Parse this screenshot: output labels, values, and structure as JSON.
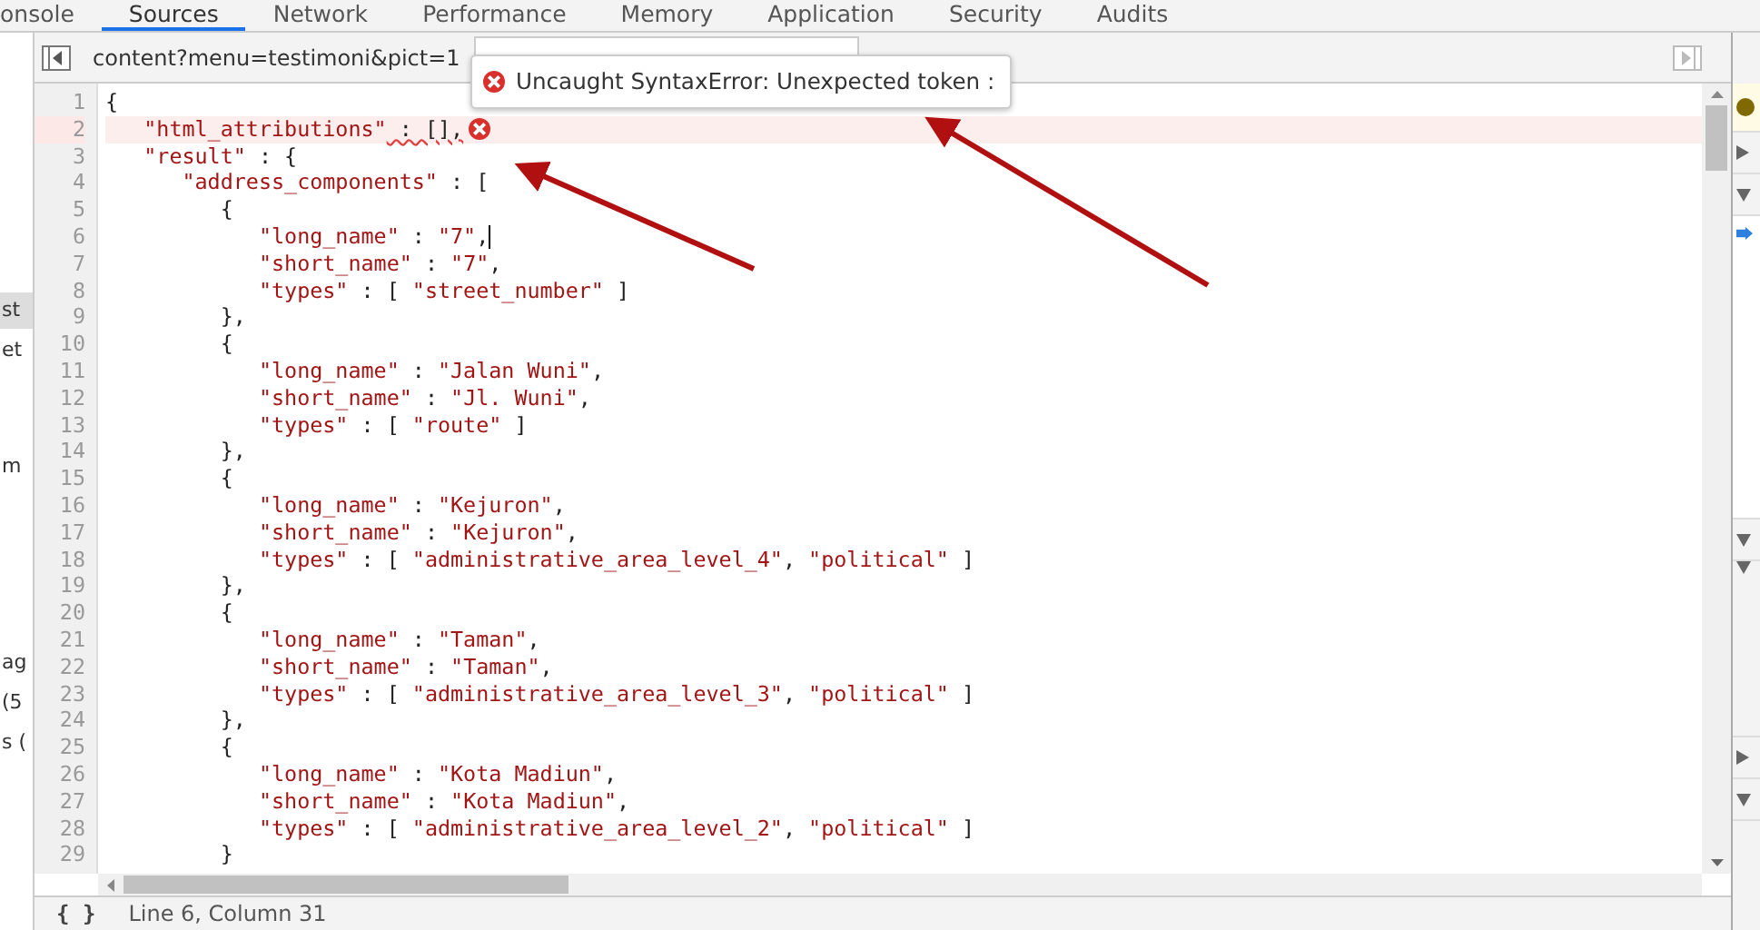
{
  "panel_tabs": [
    {
      "label": "onsole",
      "selected": false
    },
    {
      "label": "Sources",
      "selected": true
    },
    {
      "label": "Network",
      "selected": false
    },
    {
      "label": "Performance",
      "selected": false
    },
    {
      "label": "Memory",
      "selected": false
    },
    {
      "label": "Application",
      "selected": false
    },
    {
      "label": "Security",
      "selected": false
    },
    {
      "label": "Audits",
      "selected": false
    }
  ],
  "navigator": {
    "items": [
      {
        "label": "st",
        "selected": true
      },
      {
        "label": "et",
        "selected": false
      },
      {
        "label": "m",
        "selected": false
      },
      {
        "label": "ag",
        "selected": false
      },
      {
        "label": "(5",
        "selected": false
      },
      {
        "label": "s (",
        "selected": false
      }
    ]
  },
  "editor": {
    "file_tabs": [
      {
        "label": "content?menu=testimoni&pict=1",
        "selected": true
      }
    ],
    "error_tooltip": {
      "message": "Uncaught SyntaxError: Unexpected token :"
    },
    "lines": [
      {
        "number": "1",
        "text": "{",
        "error": false,
        "cursor": false
      },
      {
        "number": "2",
        "text": "   \"html_attributions\" : [],",
        "error": true,
        "cursor": false
      },
      {
        "number": "3",
        "text": "   \"result\" : {",
        "error": false,
        "cursor": false
      },
      {
        "number": "4",
        "text": "      \"address_components\" : [",
        "error": false,
        "cursor": false
      },
      {
        "number": "5",
        "text": "         {",
        "error": false,
        "cursor": false
      },
      {
        "number": "6",
        "text": "            \"long_name\" : \"7\",",
        "error": false,
        "cursor": true
      },
      {
        "number": "7",
        "text": "            \"short_name\" : \"7\",",
        "error": false,
        "cursor": false
      },
      {
        "number": "8",
        "text": "            \"types\" : [ \"street_number\" ]",
        "error": false,
        "cursor": false
      },
      {
        "number": "9",
        "text": "         },",
        "error": false,
        "cursor": false
      },
      {
        "number": "10",
        "text": "         {",
        "error": false,
        "cursor": false
      },
      {
        "number": "11",
        "text": "            \"long_name\" : \"Jalan Wuni\",",
        "error": false,
        "cursor": false
      },
      {
        "number": "12",
        "text": "            \"short_name\" : \"Jl. Wuni\",",
        "error": false,
        "cursor": false
      },
      {
        "number": "13",
        "text": "            \"types\" : [ \"route\" ]",
        "error": false,
        "cursor": false
      },
      {
        "number": "14",
        "text": "         },",
        "error": false,
        "cursor": false
      },
      {
        "number": "15",
        "text": "         {",
        "error": false,
        "cursor": false
      },
      {
        "number": "16",
        "text": "            \"long_name\" : \"Kejuron\",",
        "error": false,
        "cursor": false
      },
      {
        "number": "17",
        "text": "            \"short_name\" : \"Kejuron\",",
        "error": false,
        "cursor": false
      },
      {
        "number": "18",
        "text": "            \"types\" : [ \"administrative_area_level_4\", \"political\" ]",
        "error": false,
        "cursor": false
      },
      {
        "number": "19",
        "text": "         },",
        "error": false,
        "cursor": false
      },
      {
        "number": "20",
        "text": "         {",
        "error": false,
        "cursor": false
      },
      {
        "number": "21",
        "text": "            \"long_name\" : \"Taman\",",
        "error": false,
        "cursor": false
      },
      {
        "number": "22",
        "text": "            \"short_name\" : \"Taman\",",
        "error": false,
        "cursor": false
      },
      {
        "number": "23",
        "text": "            \"types\" : [ \"administrative_area_level_3\", \"political\" ]",
        "error": false,
        "cursor": false
      },
      {
        "number": "24",
        "text": "         },",
        "error": false,
        "cursor": false
      },
      {
        "number": "25",
        "text": "         {",
        "error": false,
        "cursor": false
      },
      {
        "number": "26",
        "text": "            \"long_name\" : \"Kota Madiun\",",
        "error": false,
        "cursor": false
      },
      {
        "number": "27",
        "text": "            \"short_name\" : \"Kota Madiun\",",
        "error": false,
        "cursor": false
      },
      {
        "number": "28",
        "text": "            \"types\" : [ \"administrative_area_level_2\", \"political\" ]",
        "error": false,
        "cursor": false
      },
      {
        "number": "29",
        "text": "         }",
        "error": false,
        "cursor": false
      }
    ],
    "pretty_print": "{ }",
    "status": "Line 6, Column 31"
  }
}
